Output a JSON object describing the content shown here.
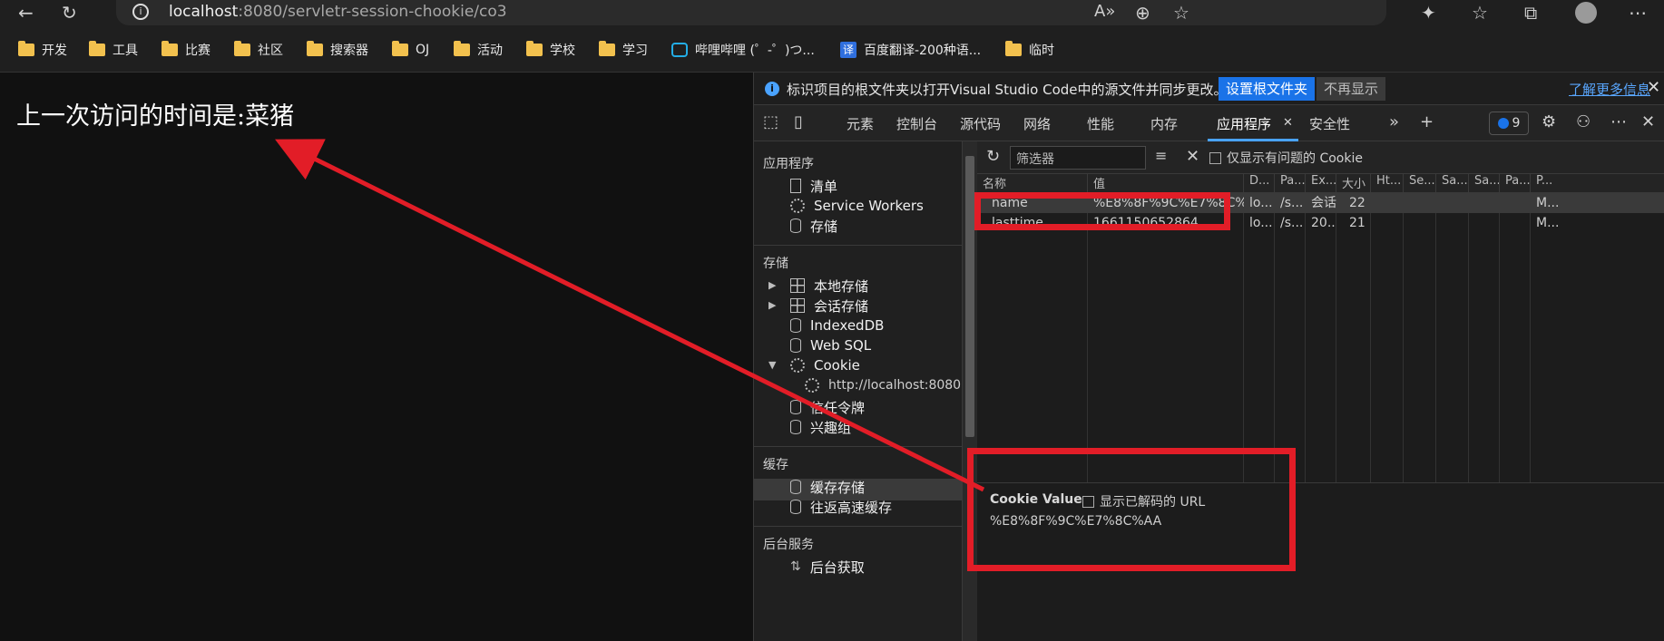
{
  "browser": {
    "url_host": "localhost",
    "url_path": ":8080/servletr-session-chookie/co3",
    "info_icon": "info-icon"
  },
  "bookmarks": [
    {
      "label": "开发",
      "icon": "folder-icon"
    },
    {
      "label": "工具",
      "icon": "folder-icon"
    },
    {
      "label": "比赛",
      "icon": "folder-icon"
    },
    {
      "label": "社区",
      "icon": "folder-icon"
    },
    {
      "label": "搜索器",
      "icon": "folder-icon"
    },
    {
      "label": "OJ",
      "icon": "folder-icon"
    },
    {
      "label": "活动",
      "icon": "folder-icon"
    },
    {
      "label": "学校",
      "icon": "folder-icon"
    },
    {
      "label": "学习",
      "icon": "folder-icon"
    },
    {
      "label": "哔哩哔哩 (゜-゜)つ...",
      "icon": "bilibili-icon"
    },
    {
      "label": "百度翻译-200种语...",
      "icon": "translate-icon"
    },
    {
      "label": "临时",
      "icon": "folder-icon"
    }
  ],
  "page": {
    "text": "上一次访问的时间是:菜猪"
  },
  "devtools": {
    "infobar": {
      "message": "标识项目的根文件夹以打开Visual Studio Code中的源文件并同步更改。",
      "set_root": "设置根文件夹",
      "dont_show": "不再显示",
      "learn_more": "了解更多信息"
    },
    "tabs": [
      "元素",
      "控制台",
      "源代码",
      "网络",
      "性能",
      "内存",
      "应用程序",
      "安全性"
    ],
    "active_tab": "应用程序",
    "issues_count": "9",
    "sidebar": {
      "app_section": "应用程序",
      "app_items": [
        "清单",
        "Service Workers",
        "存储"
      ],
      "storage_section": "存储",
      "storage_items": [
        "本地存储",
        "会话存储",
        "IndexedDB",
        "Web SQL",
        "Cookie"
      ],
      "cookie_origin": "http://localhost:8080",
      "storage_items2": [
        "信任令牌",
        "兴趣组"
      ],
      "cache_section": "缓存",
      "cache_items": [
        "缓存存储",
        "往返高速缓存"
      ],
      "background_section": "后台服务",
      "background_items": [
        "后台获取"
      ]
    },
    "cookies": {
      "filter_placeholder": "筛选器",
      "only_issues": "仅显示有问题的 Cookie",
      "columns": [
        "名称",
        "值",
        "D...",
        "Pa...",
        "Ex...",
        "大小",
        "Ht...",
        "Se...",
        "Sa...",
        "Sa...",
        "Pa...",
        "P..."
      ],
      "rows": [
        [
          "name",
          "%E8%8F%9C%E7%8C%AA",
          "lo...",
          "/s...",
          "会话",
          "22",
          "",
          "",
          "",
          "",
          "",
          "M..."
        ],
        [
          "lasttime",
          "1661150652864",
          "lo...",
          "/s...",
          "20...",
          "21",
          "",
          "",
          "",
          "",
          "",
          "M..."
        ]
      ],
      "value_title": "Cookie Value",
      "show_decoded": "显示已解码的 URL",
      "value": "%E8%8F%9C%E7%8C%AA"
    }
  },
  "colors": {
    "annotation_red": "#e21d27",
    "accent_blue": "#1a73e8"
  }
}
